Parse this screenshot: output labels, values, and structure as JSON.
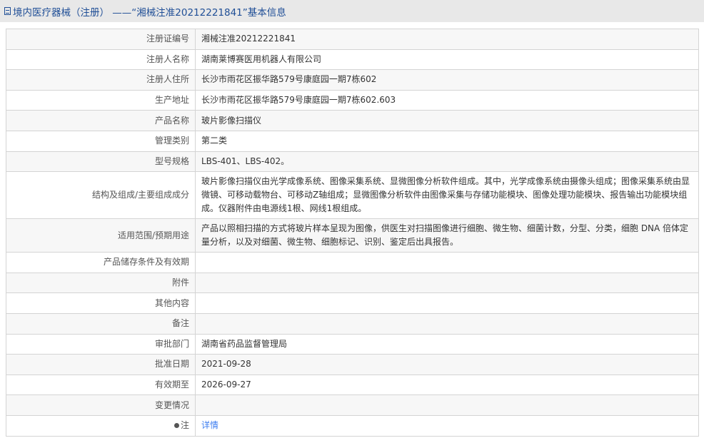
{
  "header": {
    "title": "境内医疗器械（注册） ——“湘械注准20212221841”基本信息"
  },
  "rows": [
    {
      "label": "注册证编号",
      "value": "湘械注准20212221841"
    },
    {
      "label": "注册人名称",
      "value": "湖南莱博赛医用机器人有限公司"
    },
    {
      "label": "注册人住所",
      "value": "长沙市雨花区振华路579号康庭园一期7栋602"
    },
    {
      "label": "生产地址",
      "value": "长沙市雨花区振华路579号康庭园一期7栋602.603"
    },
    {
      "label": "产品名称",
      "value": "玻片影像扫描仪"
    },
    {
      "label": "管理类别",
      "value": "第二类"
    },
    {
      "label": "型号规格",
      "value": "LBS-401、LBS-402。"
    },
    {
      "label": "结构及组成/主要组成成分",
      "value": "玻片影像扫描仪由光学成像系统、图像采集系统、显微图像分析软件组成。其中，光学成像系统由摄像头组成；图像采集系统由显微镜、可移动载物台、可移动Z轴组成；显微图像分析软件由图像采集与存储功能模块、图像处理功能模块、报告输出功能模块组成。仪器附件由电源线1根、网线1根组成。"
    },
    {
      "label": "适用范围/预期用途",
      "value": "产品以照相扫描的方式将玻片样本呈现为图像，供医生对扫描图像进行细胞、微生物、细菌计数，分型、分类，细胞 DNA 倍体定量分析，以及对细菌、微生物、细胞标记、识别、鉴定后出具报告。"
    },
    {
      "label": "产品储存条件及有效期",
      "value": ""
    },
    {
      "label": "附件",
      "value": ""
    },
    {
      "label": "其他内容",
      "value": ""
    },
    {
      "label": "备注",
      "value": ""
    },
    {
      "label": "审批部门",
      "value": "湖南省药品监督管理局"
    },
    {
      "label": "批准日期",
      "value": "2021-09-28"
    },
    {
      "label": "有效期至",
      "value": "2026-09-27"
    },
    {
      "label": "变更情况",
      "value": ""
    }
  ],
  "note": {
    "label": "注",
    "link": "详情"
  }
}
